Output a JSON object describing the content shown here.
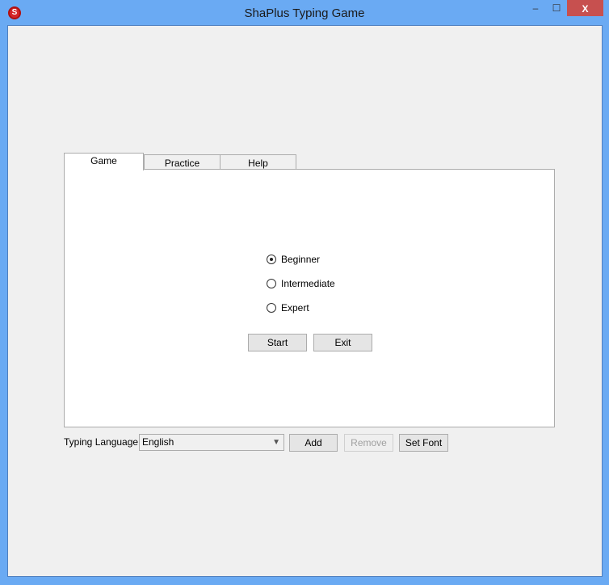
{
  "window": {
    "title": "ShaPlus Typing Game",
    "icon": "S",
    "minimize": "‒",
    "maximize": "☐",
    "close": "X"
  },
  "tabs": [
    {
      "label": "Game",
      "active": true
    },
    {
      "label": "Practice"
    },
    {
      "label": "Help"
    }
  ],
  "levels": [
    {
      "label": "Beginner",
      "selected": true
    },
    {
      "label": "Intermediate",
      "selected": false
    },
    {
      "label": "Expert",
      "selected": false
    }
  ],
  "buttons": {
    "start": "Start",
    "exit": "Exit",
    "add": "Add",
    "remove": "Remove",
    "set_font": "Set Font"
  },
  "language": {
    "label": "Typing Language",
    "value": "English"
  }
}
